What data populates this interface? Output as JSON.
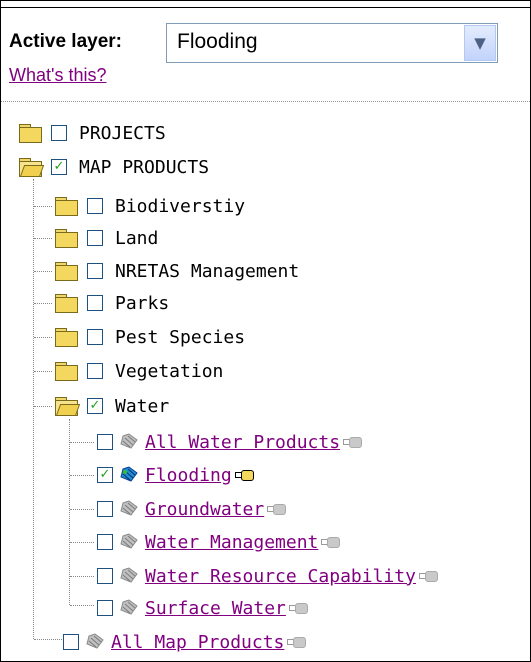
{
  "panel": {
    "active_layer_label": "Active layer:",
    "active_layer_value": "Flooding",
    "whats_this": "What's this?"
  },
  "tree": {
    "projects": "PROJECTS",
    "map_products": "MAP PRODUCTS",
    "folders": [
      "Biodiverstiy",
      "Land",
      "NRETAS Management",
      "Parks",
      "Pest Species",
      "Vegetation"
    ],
    "water": "Water",
    "water_layers": [
      "All Water Products",
      "Flooding",
      "Groundwater",
      "Water Management",
      "Water Resource Capability",
      "Surface Water"
    ],
    "all_map_products": "All Map Products"
  },
  "state": {
    "map_products_checked": true,
    "water_checked": true,
    "flooding_checked": true
  },
  "colors": {
    "link": "#800080",
    "check": "#21a121",
    "folder": "#f3d75f"
  }
}
